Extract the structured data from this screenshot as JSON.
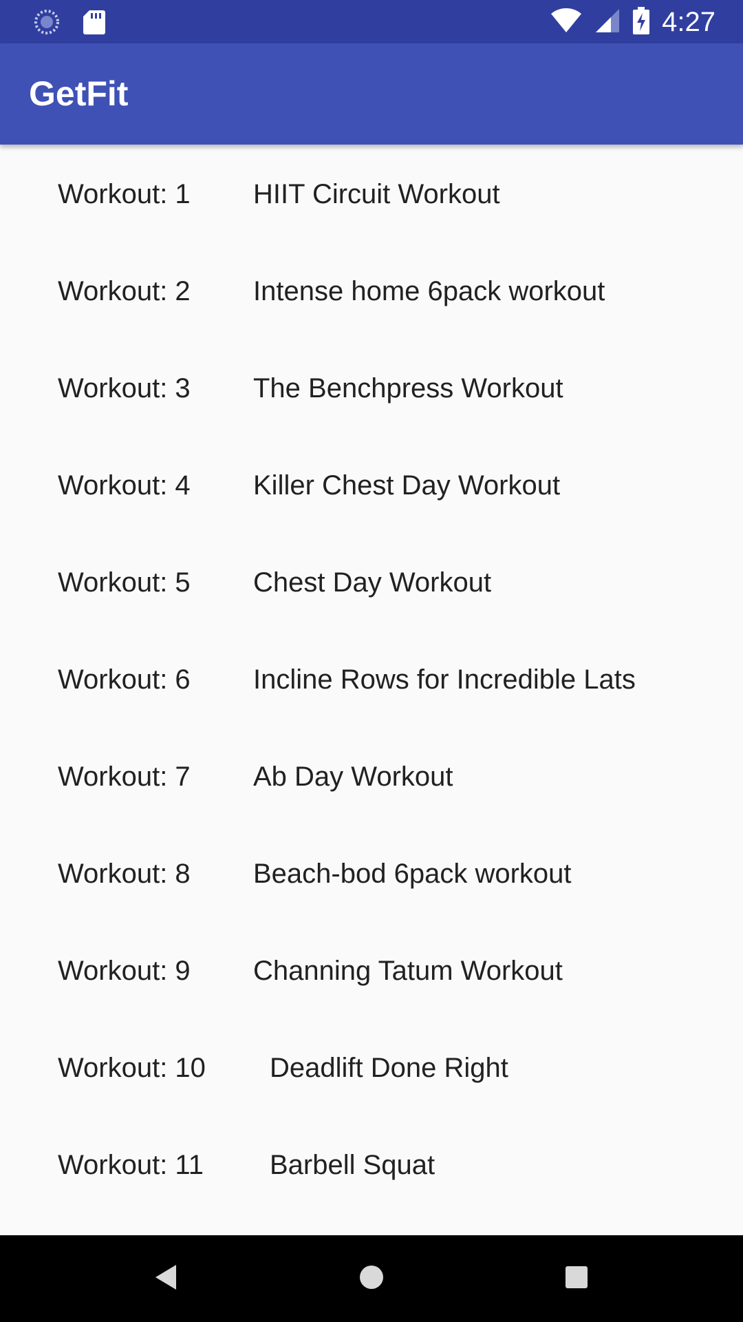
{
  "status_bar": {
    "time": "4:27",
    "icons": [
      "sync-icon",
      "sd-card-icon",
      "wifi-icon",
      "signal-icon",
      "battery-charging-icon"
    ]
  },
  "app_bar": {
    "title": "GetFit"
  },
  "workouts": [
    {
      "number": "Workout: 1",
      "title": "HIIT Circuit Workout"
    },
    {
      "number": "Workout: 2",
      "title": "Intense home 6pack workout"
    },
    {
      "number": "Workout: 3",
      "title": "The Benchpress Workout"
    },
    {
      "number": "Workout: 4",
      "title": "Killer Chest Day Workout"
    },
    {
      "number": "Workout: 5",
      "title": "Chest Day Workout"
    },
    {
      "number": "Workout: 6",
      "title": "Incline Rows for Incredible Lats"
    },
    {
      "number": "Workout: 7",
      "title": "Ab Day Workout"
    },
    {
      "number": "Workout: 8",
      "title": "Beach-bod 6pack workout"
    },
    {
      "number": "Workout: 9",
      "title": "Channing Tatum Workout"
    },
    {
      "number": "Workout: 10",
      "title": "Deadlift Done Right"
    },
    {
      "number": "Workout: 11",
      "title": "Barbell Squat"
    }
  ],
  "nav_bar": {
    "buttons": [
      "back-icon",
      "home-icon",
      "recents-icon"
    ]
  },
  "colors": {
    "status_bar": "#303F9F",
    "app_bar": "#3F51B5",
    "background": "#FAFAFA",
    "text": "#212121",
    "nav_bar": "#000000"
  }
}
